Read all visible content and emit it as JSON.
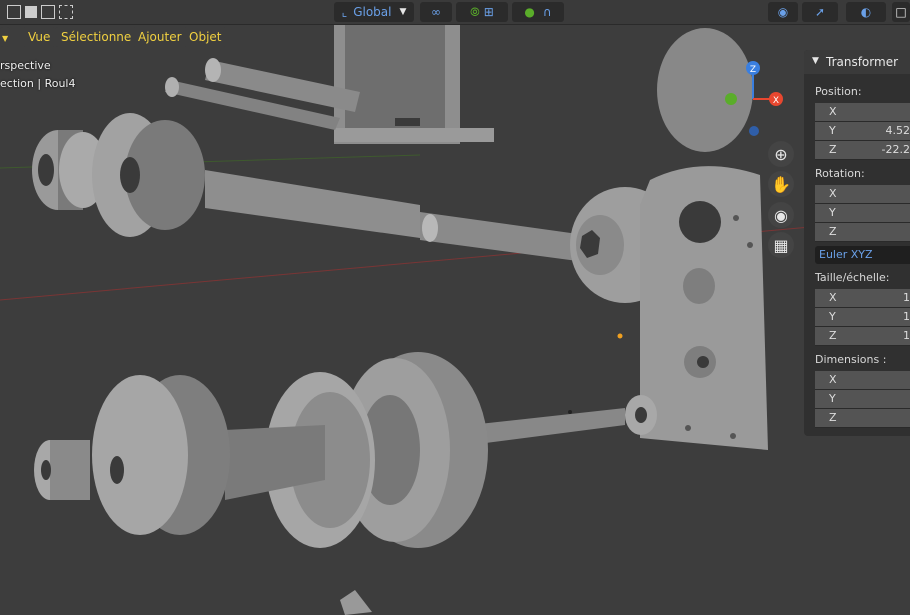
{
  "header": {
    "transform_orientation": "Global",
    "menus": [
      "Vue",
      "Sélectionner",
      "Ajouter",
      "Objet"
    ]
  },
  "viewport_overlay": {
    "view_name": "rspective",
    "collection_line": "ection | Roul4"
  },
  "sidebar": {
    "panel_title": "Transformer",
    "position_label": "Position:",
    "position": {
      "x": "",
      "y": "4.52",
      "z": "-22.2"
    },
    "rotation_label": "Rotation:",
    "rotation": {
      "x": "",
      "y": "",
      "z": ""
    },
    "rotation_mode": "Euler XYZ",
    "scale_label": "Taille/échelle:",
    "scale": {
      "x": "1",
      "y": "1",
      "z": "1"
    },
    "dimensions_label": "Dimensions :",
    "dimensions": {
      "x": "",
      "y": "",
      "z": ""
    },
    "axis_labels": {
      "x": "X",
      "y": "Y",
      "z": "Z"
    }
  },
  "gizmo": {
    "axis_x": "X",
    "axis_z": "Z",
    "color_x": "#e8472f",
    "color_y": "#5aad2a",
    "color_z": "#3a7fe0"
  },
  "colors": {
    "menu_text": "#f0d040",
    "background": "#3d3d3d",
    "accent": "#6aa0e8"
  }
}
